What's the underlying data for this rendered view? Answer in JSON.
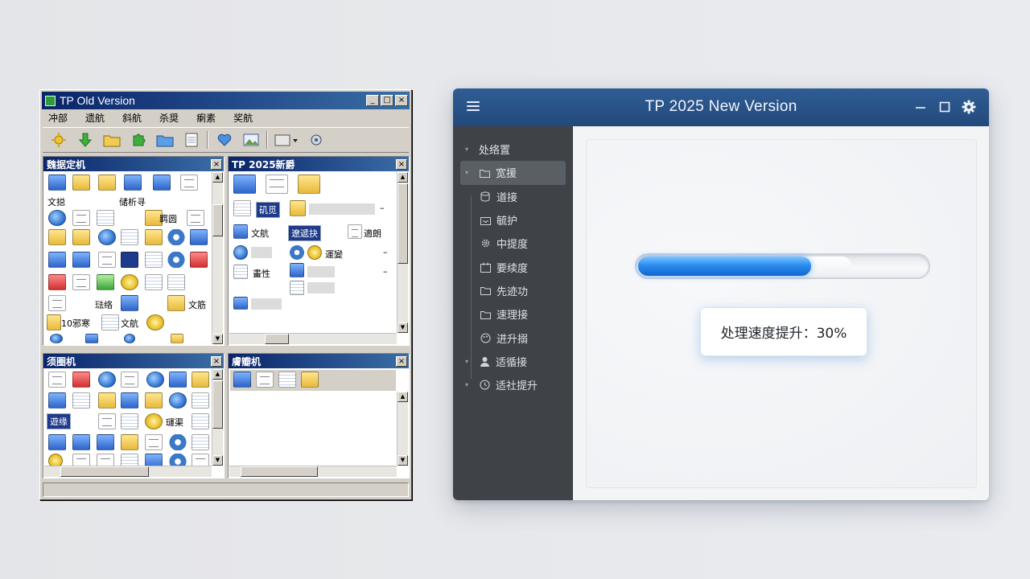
{
  "old_window": {
    "title": "TP Old Version",
    "controls": {
      "minimize": "_",
      "maximize": "□",
      "close": "×"
    },
    "menu": [
      "冲部",
      "遗航",
      "斜航",
      "杀奨",
      "瘌素",
      "奖航"
    ],
    "panes": {
      "top_left": {
        "title": "魏据定机",
        "labels": {
          "a": "文搃",
          "b": "储析寻",
          "c": "羁圆",
          "d": "琺络",
          "e": "文筋",
          "f": "10邪寒",
          "g": "文航"
        }
      },
      "top_right": {
        "title": "TP 2025新爵",
        "labels": {
          "a": "矶觅",
          "b": "文航",
          "c": "遼遞抉",
          "d": "適朗",
          "e": "運變",
          "f": "畫性"
        }
      },
      "bottom_left": {
        "title": "须圈机",
        "labels": {
          "a": "遊缘",
          "b": "璭渠"
        }
      },
      "bottom_right": {
        "title": "膚瓣机"
      }
    }
  },
  "new_window": {
    "title": "TP 2025 New Version",
    "sidebar": [
      {
        "label": "处络置",
        "icon": "none",
        "chevron": "▾",
        "level": 0,
        "active": false
      },
      {
        "label": "宽援",
        "icon": "folder-icon",
        "chevron": "▾",
        "level": 0,
        "active": true
      },
      {
        "label": "道接",
        "icon": "database-icon",
        "chevron": "",
        "level": 1,
        "active": false
      },
      {
        "label": "毓护",
        "icon": "inbox-icon",
        "chevron": "",
        "level": 1,
        "active": false
      },
      {
        "label": "中提度",
        "icon": "gear-icon",
        "chevron": "",
        "level": 1,
        "active": false
      },
      {
        "label": "要续度",
        "icon": "calendar-icon",
        "chevron": "",
        "level": 1,
        "active": false
      },
      {
        "label": "先迹功",
        "icon": "folder-icon",
        "chevron": "",
        "level": 1,
        "active": false
      },
      {
        "label": "速理接",
        "icon": "folder-icon",
        "chevron": "",
        "level": 1,
        "active": false
      },
      {
        "label": "进升搦",
        "icon": "palette-icon",
        "chevron": "",
        "level": 1,
        "active": false
      },
      {
        "label": "适循接",
        "icon": "user-icon",
        "chevron": "▾",
        "level": 0,
        "active": false
      },
      {
        "label": "适社提升",
        "icon": "clock-icon",
        "chevron": "▾",
        "level": 0,
        "active": false
      }
    ],
    "progress": {
      "value": 0.6,
      "ghost_to": 0.74
    },
    "status_text": "处理速度提升：30%"
  }
}
